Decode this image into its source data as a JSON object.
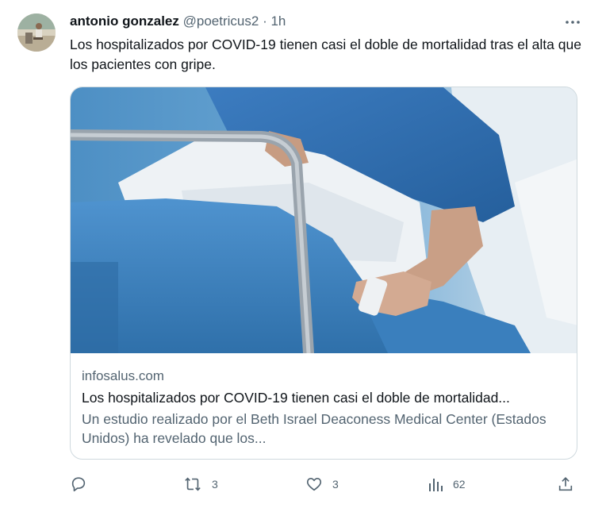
{
  "tweet": {
    "author_name": "antonio gonzalez",
    "author_handle": "@poetricus2",
    "separator": "·",
    "time": "1h",
    "text": "Los hospitalizados por COVID-19 tienen casi el doble de mortalidad tras el alta que los pacientes con gripe."
  },
  "card": {
    "domain": "infosalus.com",
    "title": "Los hospitalizados por COVID-19 tienen casi el doble de mortalidad...",
    "description": "Un estudio realizado por el Beth Israel Deaconess Medical Center (Estados Unidos) ha revelado que los..."
  },
  "actions": {
    "reply_icon": "reply-icon",
    "retweet_icon": "retweet-icon",
    "retweet_count": "3",
    "like_icon": "heart-icon",
    "like_count": "3",
    "views_icon": "views-icon",
    "views_count": "62",
    "share_icon": "share-icon"
  },
  "colors": {
    "text": "#0f1419",
    "secondary": "#536471",
    "border": "#cfd9de"
  }
}
